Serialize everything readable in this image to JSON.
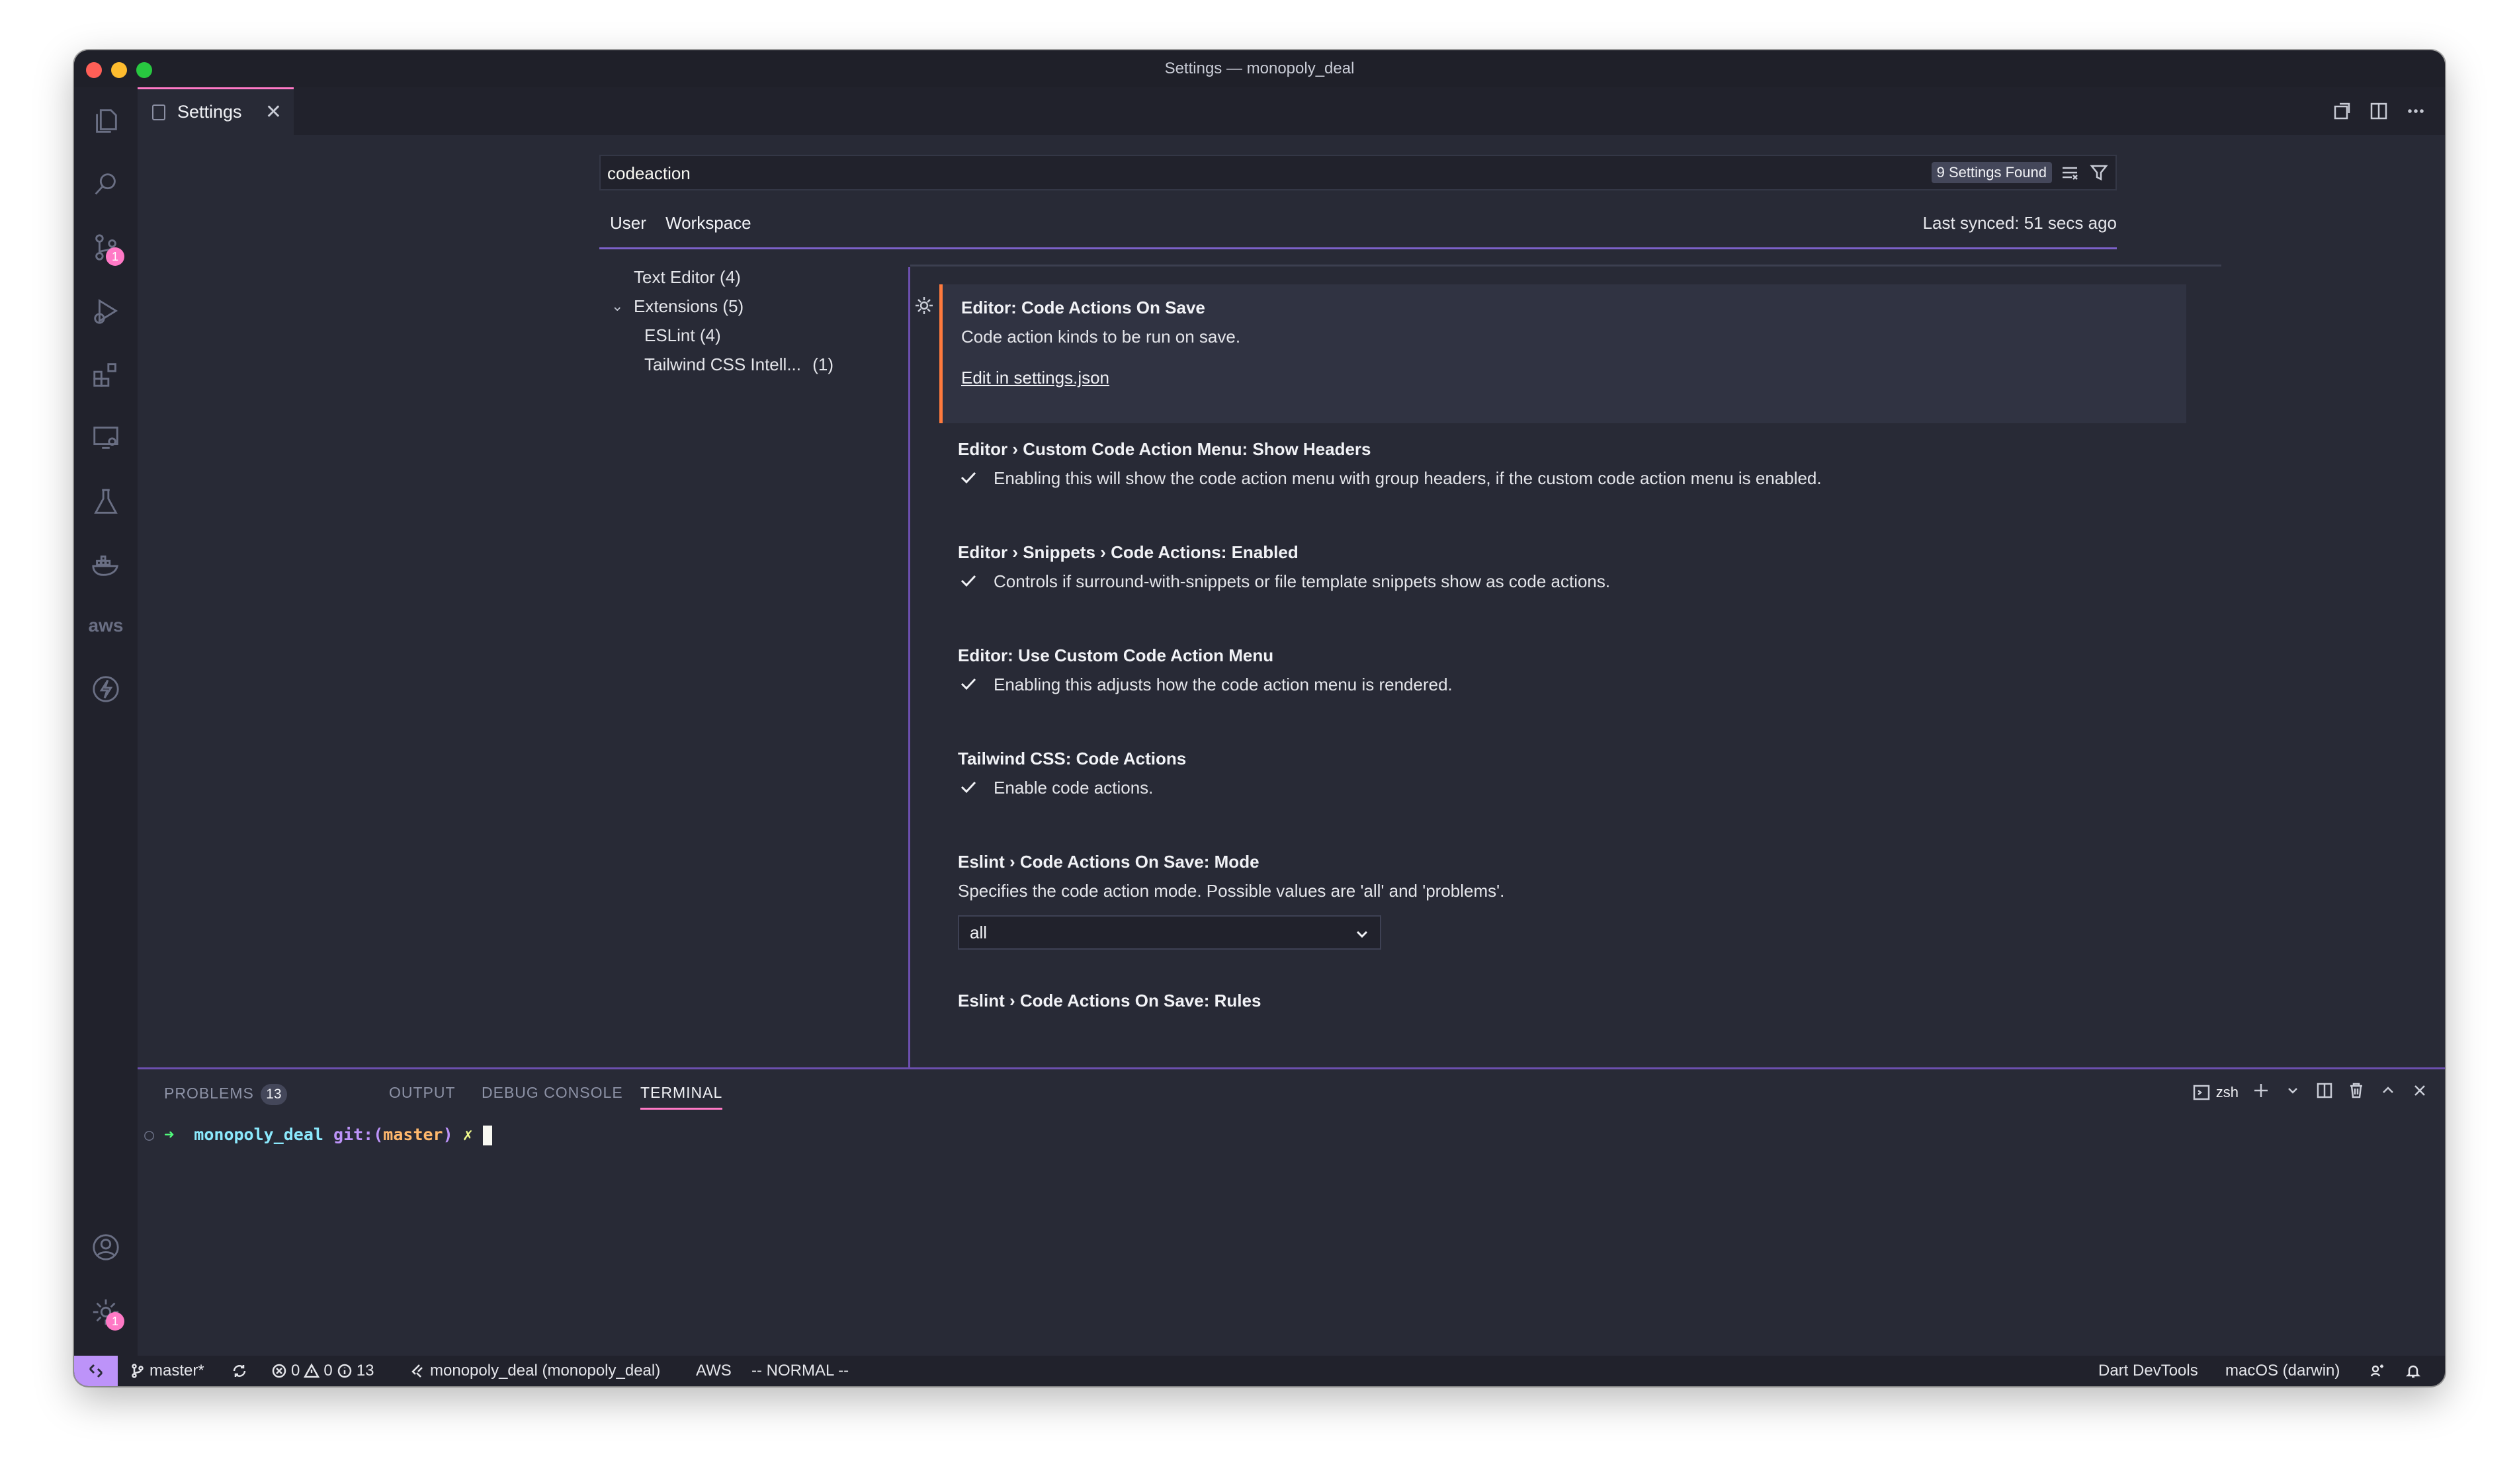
{
  "window": {
    "title": "Settings — monopoly_deal"
  },
  "activity_bar": {
    "items": [
      {
        "name": "explorer-icon"
      },
      {
        "name": "search-icon"
      },
      {
        "name": "source-control-icon",
        "badge": "1"
      },
      {
        "name": "run-debug-icon"
      },
      {
        "name": "extensions-icon"
      },
      {
        "name": "remote-explorer-icon"
      },
      {
        "name": "testing-icon"
      },
      {
        "name": "docker-icon"
      },
      {
        "name": "aws-icon",
        "text": "aws"
      },
      {
        "name": "thunder-icon"
      }
    ],
    "accounts_icon": "account-icon",
    "manage": {
      "icon": "gear-icon",
      "badge": "1"
    }
  },
  "tab": {
    "label": "Settings",
    "close": "✕"
  },
  "settings": {
    "search_value": "codeaction",
    "found": "9 Settings Found",
    "scope_tabs": [
      "User",
      "Workspace"
    ],
    "last_synced": "Last synced: 51 secs ago",
    "toc": [
      {
        "label": "Text Editor (4)"
      },
      {
        "label": "Extensions (5)"
      },
      {
        "label": "ESLint (4)"
      },
      {
        "label": "Tailwind CSS Intell...",
        "count": "(1)"
      }
    ],
    "items": [
      {
        "title": "Editor: Code Actions On Save",
        "description": "Code action kinds to be run on save.",
        "link": "Edit in settings.json"
      },
      {
        "title": "Editor › Custom Code Action Menu: Show Headers",
        "description": "Enabling this will show the code action menu with group headers, if the custom code action menu is enabled.",
        "checked": true
      },
      {
        "title": "Editor › Snippets › Code Actions: Enabled",
        "description": "Controls if surround-with-snippets or file template snippets show as code actions.",
        "checked": true
      },
      {
        "title": "Editor: Use Custom Code Action Menu",
        "description": "Enabling this adjusts how the code action menu is rendered.",
        "checked": true
      },
      {
        "title": "Tailwind CSS: Code Actions",
        "description": "Enable code actions.",
        "checked": true
      },
      {
        "title": "Eslint › Code Actions On Save: Mode",
        "description": "Specifies the code action mode. Possible values are 'all' and 'problems'.",
        "select_value": "all"
      },
      {
        "title": "Eslint › Code Actions On Save: Rules"
      }
    ]
  },
  "panel": {
    "tabs": [
      {
        "label": "PROBLEMS",
        "badge": "13"
      },
      {
        "label": "OUTPUT"
      },
      {
        "label": "DEBUG CONSOLE"
      },
      {
        "label": "TERMINAL"
      }
    ],
    "shell": "zsh",
    "terminal": {
      "dot": "○",
      "arrow": "➜",
      "dir": "monopoly_deal",
      "git_label": "git:(",
      "branch": "master",
      "git_close": ")",
      "dirty": "✗"
    }
  },
  "statusbar": {
    "branch": "master*",
    "errors": "0",
    "warnings": "0",
    "infos": "13",
    "project": "monopoly_deal (monopoly_deal)",
    "aws": "AWS",
    "vim_mode": "-- NORMAL --",
    "dart": "Dart DevTools",
    "os": "macOS (darwin)"
  },
  "colors": {
    "accent": "#ff79c6",
    "focus_border": "#ff7a3d",
    "remote": "#bd93f9",
    "background": "#282a36"
  }
}
